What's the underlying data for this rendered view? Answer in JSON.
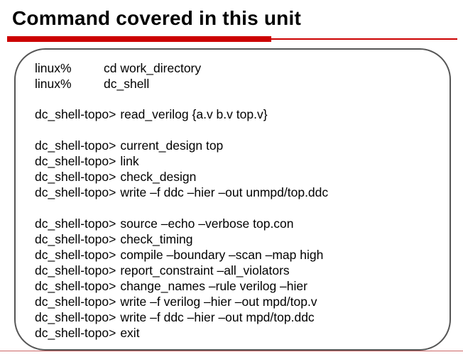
{
  "title": "Command covered in this unit",
  "colors": {
    "accent": "#cc0000",
    "box_border": "#555555"
  },
  "blocks": [
    {
      "lines": [
        {
          "prompt": "linux%",
          "command": "cd work_directory"
        },
        {
          "prompt": "linux%",
          "command": "dc_shell"
        }
      ]
    },
    {
      "lines": [
        {
          "prompt": "dc_shell-topo>",
          "command": "read_verilog {a.v b.v top.v}"
        }
      ]
    },
    {
      "lines": [
        {
          "prompt": "dc_shell-topo>",
          "command": "current_design top"
        },
        {
          "prompt": "dc_shell-topo>",
          "command": "link"
        },
        {
          "prompt": "dc_shell-topo>",
          "command": "check_design"
        },
        {
          "prompt": "dc_shell-topo>",
          "command": "write –f ddc –hier –out unmpd/top.ddc"
        }
      ]
    },
    {
      "lines": [
        {
          "prompt": "dc_shell-topo>",
          "command": "source –echo –verbose top.con"
        },
        {
          "prompt": "dc_shell-topo>",
          "command": "check_timing"
        },
        {
          "prompt": "dc_shell-topo>",
          "command": "compile –boundary –scan –map high"
        },
        {
          "prompt": "dc_shell-topo>",
          "command": "report_constraint –all_violators"
        },
        {
          "prompt": "dc_shell-topo>",
          "command": "change_names –rule verilog –hier"
        },
        {
          "prompt": "dc_shell-topo>",
          "command": "write –f verilog –hier –out mpd/top.v"
        },
        {
          "prompt": "dc_shell-topo>",
          "command": "write –f ddc –hier –out mpd/top.ddc"
        },
        {
          "prompt": "dc_shell-topo>",
          "command": "exit"
        }
      ]
    }
  ]
}
